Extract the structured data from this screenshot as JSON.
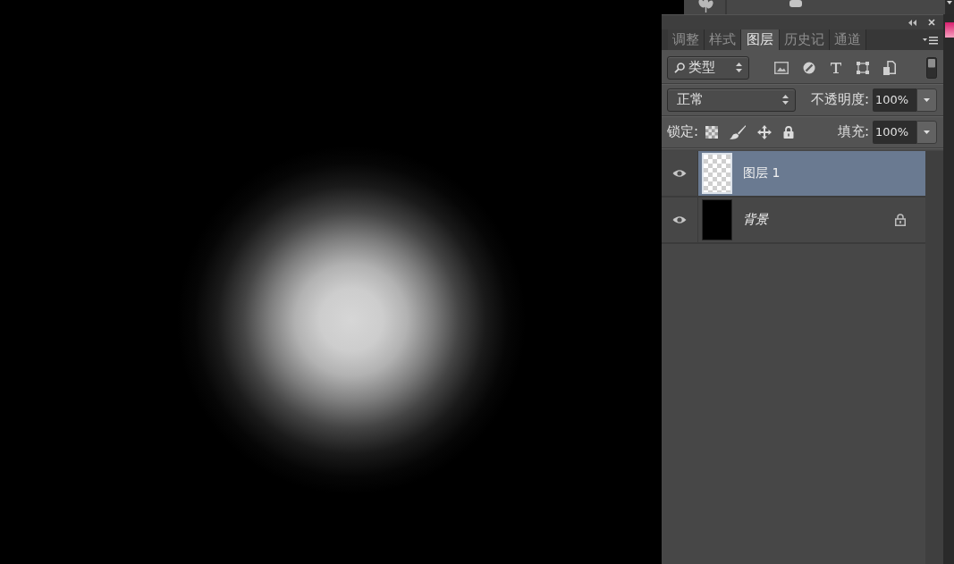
{
  "layers_panel": {
    "tabs": [
      {
        "label": "调整",
        "selected": false
      },
      {
        "label": "样式",
        "selected": false
      },
      {
        "label": "图层",
        "selected": true
      },
      {
        "label": "历史记",
        "selected": false
      },
      {
        "label": "通道",
        "selected": false
      }
    ],
    "filter": {
      "value": "类型",
      "enabled": true
    },
    "blend_mode": {
      "value": "正常"
    },
    "opacity": {
      "label": "不透明度:",
      "value": "100%"
    },
    "lock": {
      "label": "锁定:"
    },
    "fill": {
      "label": "填充:",
      "value": "100%"
    },
    "layers": [
      {
        "name": "图层 1",
        "kind": "layer",
        "selected": true,
        "visible": true,
        "locked": false
      },
      {
        "name": "背景",
        "kind": "background",
        "selected": false,
        "visible": true,
        "locked": true
      }
    ]
  }
}
